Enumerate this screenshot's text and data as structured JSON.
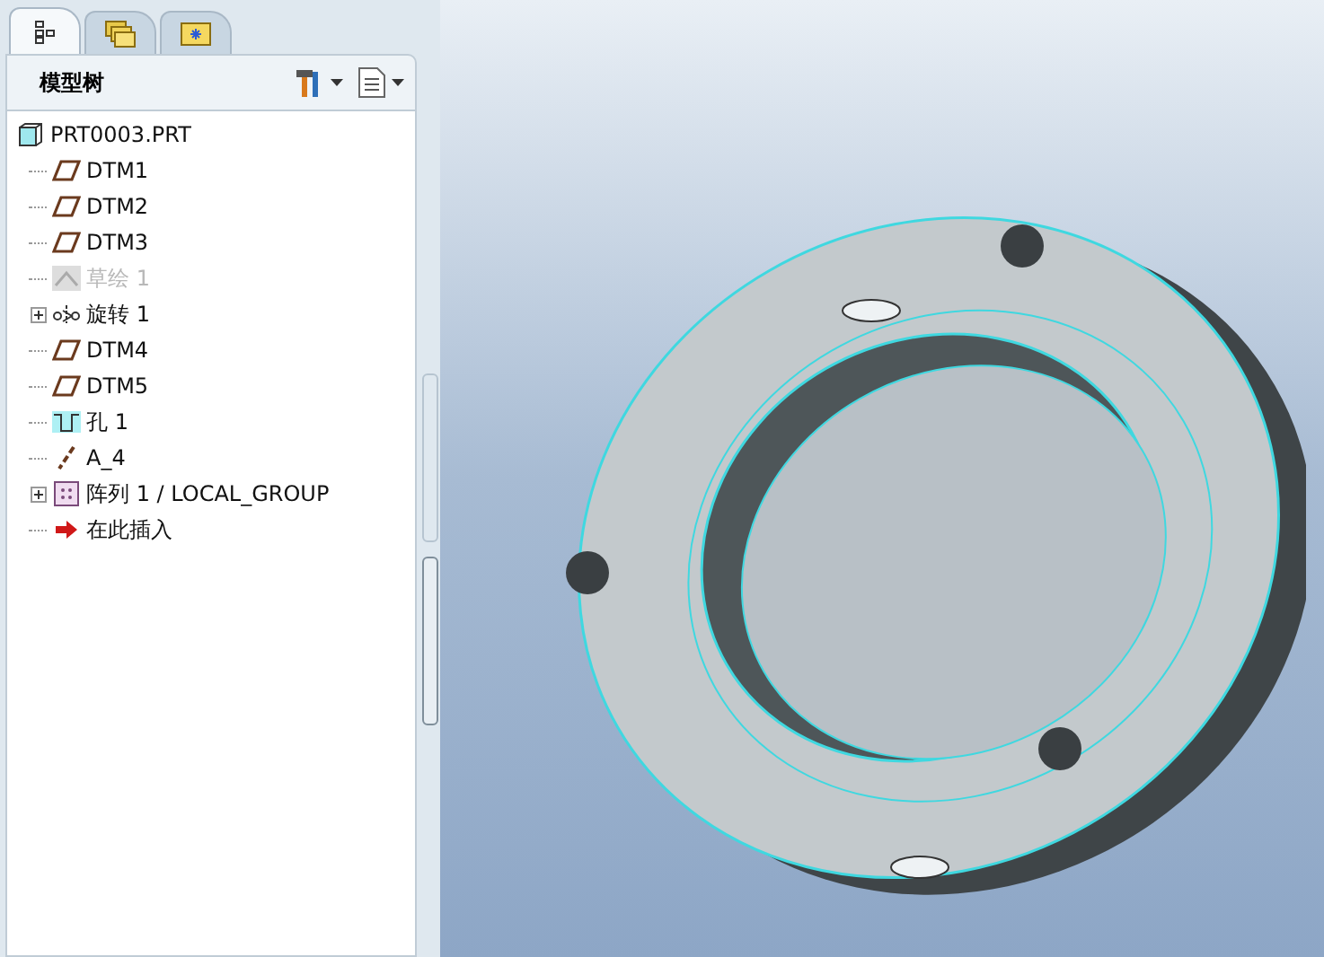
{
  "tabs": [
    {
      "kind": "tree",
      "selected": true
    },
    {
      "kind": "folders",
      "selected": false
    },
    {
      "kind": "favorites",
      "selected": false
    }
  ],
  "panel": {
    "title": "模型树"
  },
  "tree": [
    {
      "kind": "part",
      "label": "PRT0003.PRT",
      "disabled": false
    },
    {
      "kind": "datum_plane",
      "label": "DTM1",
      "disabled": false,
      "expandable": false
    },
    {
      "kind": "datum_plane",
      "label": "DTM2",
      "disabled": false,
      "expandable": false
    },
    {
      "kind": "datum_plane",
      "label": "DTM3",
      "disabled": false,
      "expandable": false
    },
    {
      "kind": "sketch",
      "label": "草绘 1",
      "disabled": true,
      "expandable": false
    },
    {
      "kind": "revolve",
      "label": "旋转 1",
      "disabled": false,
      "expandable": true
    },
    {
      "kind": "datum_plane",
      "label": "DTM4",
      "disabled": false,
      "expandable": false
    },
    {
      "kind": "datum_plane",
      "label": "DTM5",
      "disabled": false,
      "expandable": false
    },
    {
      "kind": "hole",
      "label": "孔 1",
      "disabled": false,
      "expandable": false
    },
    {
      "kind": "axis",
      "label": "A_4",
      "disabled": false,
      "expandable": false
    },
    {
      "kind": "pattern",
      "label": "阵列 1 / LOCAL_GROUP",
      "disabled": false,
      "expandable": true
    },
    {
      "kind": "insert",
      "label": "在此插入",
      "disabled": false,
      "expandable": false
    }
  ]
}
